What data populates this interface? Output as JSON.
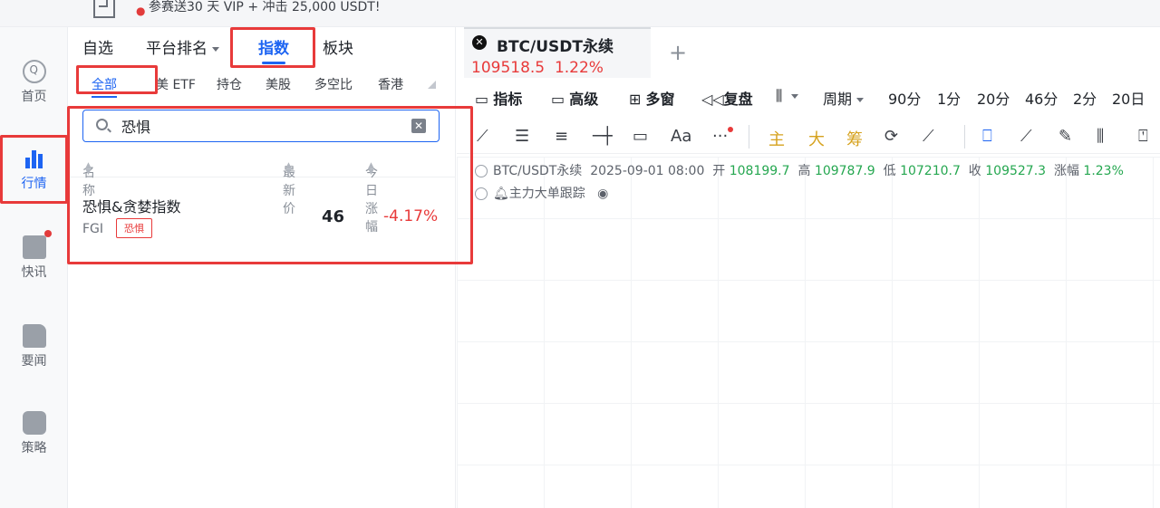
{
  "promo": {
    "text": "参赛送30 天 VIP + 冲击 25,000 USDT!"
  },
  "nav": {
    "home": "首页",
    "market": "行情",
    "news": "快讯",
    "headlines": "要闻",
    "strategy": "策略"
  },
  "market_tabs": {
    "watchlist": "自选",
    "ranking": "平台排名",
    "index": "指数",
    "sector": "板块"
  },
  "sub_tabs": {
    "all": "全部",
    "us_etf": "美 ETF",
    "position": "持仓",
    "us_stock": "美股",
    "long_short": "多空比",
    "hk": "香港"
  },
  "search": {
    "value": "恐惧"
  },
  "list_header": {
    "name": "名称",
    "price": "最新价",
    "change": "今日涨幅"
  },
  "results": [
    {
      "name": "恐惧&贪婪指数",
      "code": "FGI",
      "tag": "恐惧",
      "price": "46",
      "change": "-4.17%"
    }
  ],
  "chart": {
    "symbol": "BTC/USDT永续",
    "price": "109518.5",
    "pct": "1.22%",
    "toolbar": {
      "indicator": "指标",
      "advanced": "高级",
      "multi": "多窗",
      "replay": "复盘",
      "period": "周期",
      "intervals": [
        "90分",
        "1分",
        "20分",
        "46分",
        "2分",
        "20日"
      ]
    },
    "drawing": {
      "text": "Aa",
      "more": "···",
      "main": "主",
      "big": "大",
      "chip": "筹"
    },
    "ohlc": {
      "symbol": "BTC/USDT永续",
      "datetime": "2025-09-01 08:00",
      "open_label": "开",
      "open": "108199.7",
      "high_label": "高",
      "high": "109787.9",
      "low_label": "低",
      "low": "107210.7",
      "close_label": "收",
      "close": "109527.3",
      "chg_label": "涨幅",
      "chg": "1.23%"
    },
    "indicator_label": "主力大单跟踪"
  },
  "colors": {
    "accent": "#1d64f2",
    "down": "#e83a3a",
    "up": "#25a750",
    "gold": "#d6a21e"
  }
}
